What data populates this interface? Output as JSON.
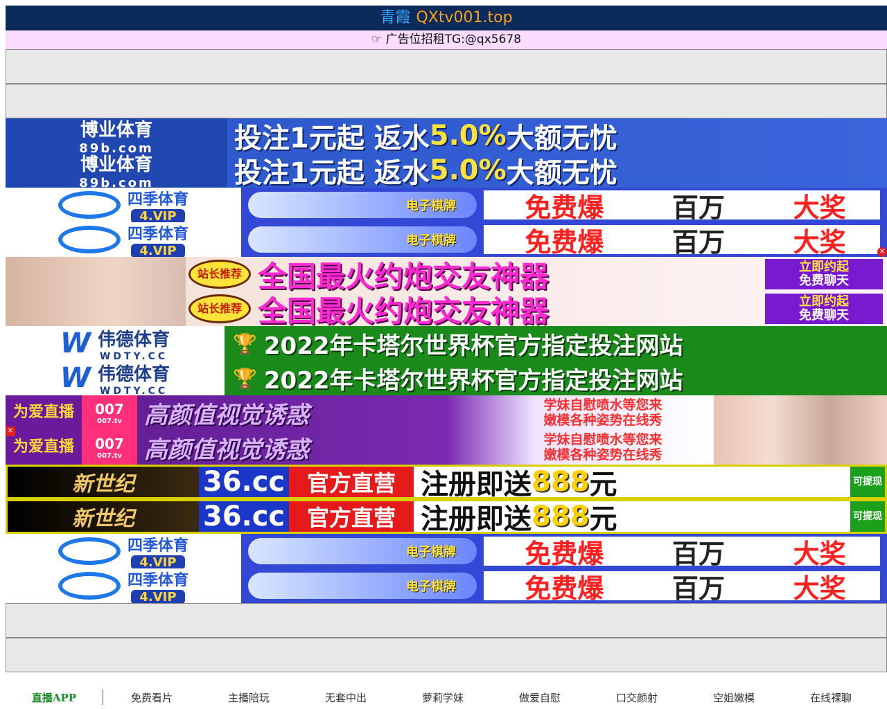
{
  "header": {
    "brand": "青霞",
    "domain": "QXtv001.top"
  },
  "ad_rent_text": "☞ 广告位招租TG:@qx5678",
  "banners": {
    "b89b": {
      "logo_line1": "博业体育",
      "logo_line2": "89b.com",
      "text_a": "投注1元起 返水 ",
      "text_hl": "5.0%",
      "text_b": " 大额无忧"
    },
    "b4vip": {
      "logo_line1": "四季体育",
      "logo_line2": "4.VIP",
      "badge": "电子棋牌",
      "text_1": "免费爆",
      "text_2": "百万",
      "text_3": "大奖"
    },
    "bdate": {
      "tag": "站长推荐",
      "text": "全国最火约炮交友神器",
      "cta_1": "立即约起",
      "cta_2": "免费聊天"
    },
    "bwdty": {
      "logo_line1": "伟德体育",
      "logo_line2": "WDTY.CC",
      "text": "2022年卡塔尔世界杯官方指定投注网站"
    },
    "b007": {
      "logo": "为爱直播",
      "tv": "007",
      "tv_sub": "007.tv",
      "text": "高颜值视觉诱惑",
      "side_1": "学妹自慰喷水等您来",
      "side_2": "嫩模各种姿势在线秀"
    },
    "b36cc": {
      "logo": "新世纪",
      "num": "36.cc",
      "red": "官方直营",
      "text_a": "注册即送",
      "text_hl": "888",
      "text_b": "元",
      "cash": "可提现"
    }
  },
  "nav": {
    "items": [
      "直播APP",
      "免费看片",
      "主播陪玩",
      "无套中出",
      "萝莉学妹",
      "做爱自慰",
      "口交颜射",
      "空姐嫩模",
      "在线裸聊"
    ]
  },
  "colors": {
    "title_bg": "#0b2b5a",
    "brand": "#3aa0ff",
    "domain": "#ff9f1a",
    "ad_rent_bg": "#f9dcff",
    "nav_active": "#1a8a2a"
  }
}
